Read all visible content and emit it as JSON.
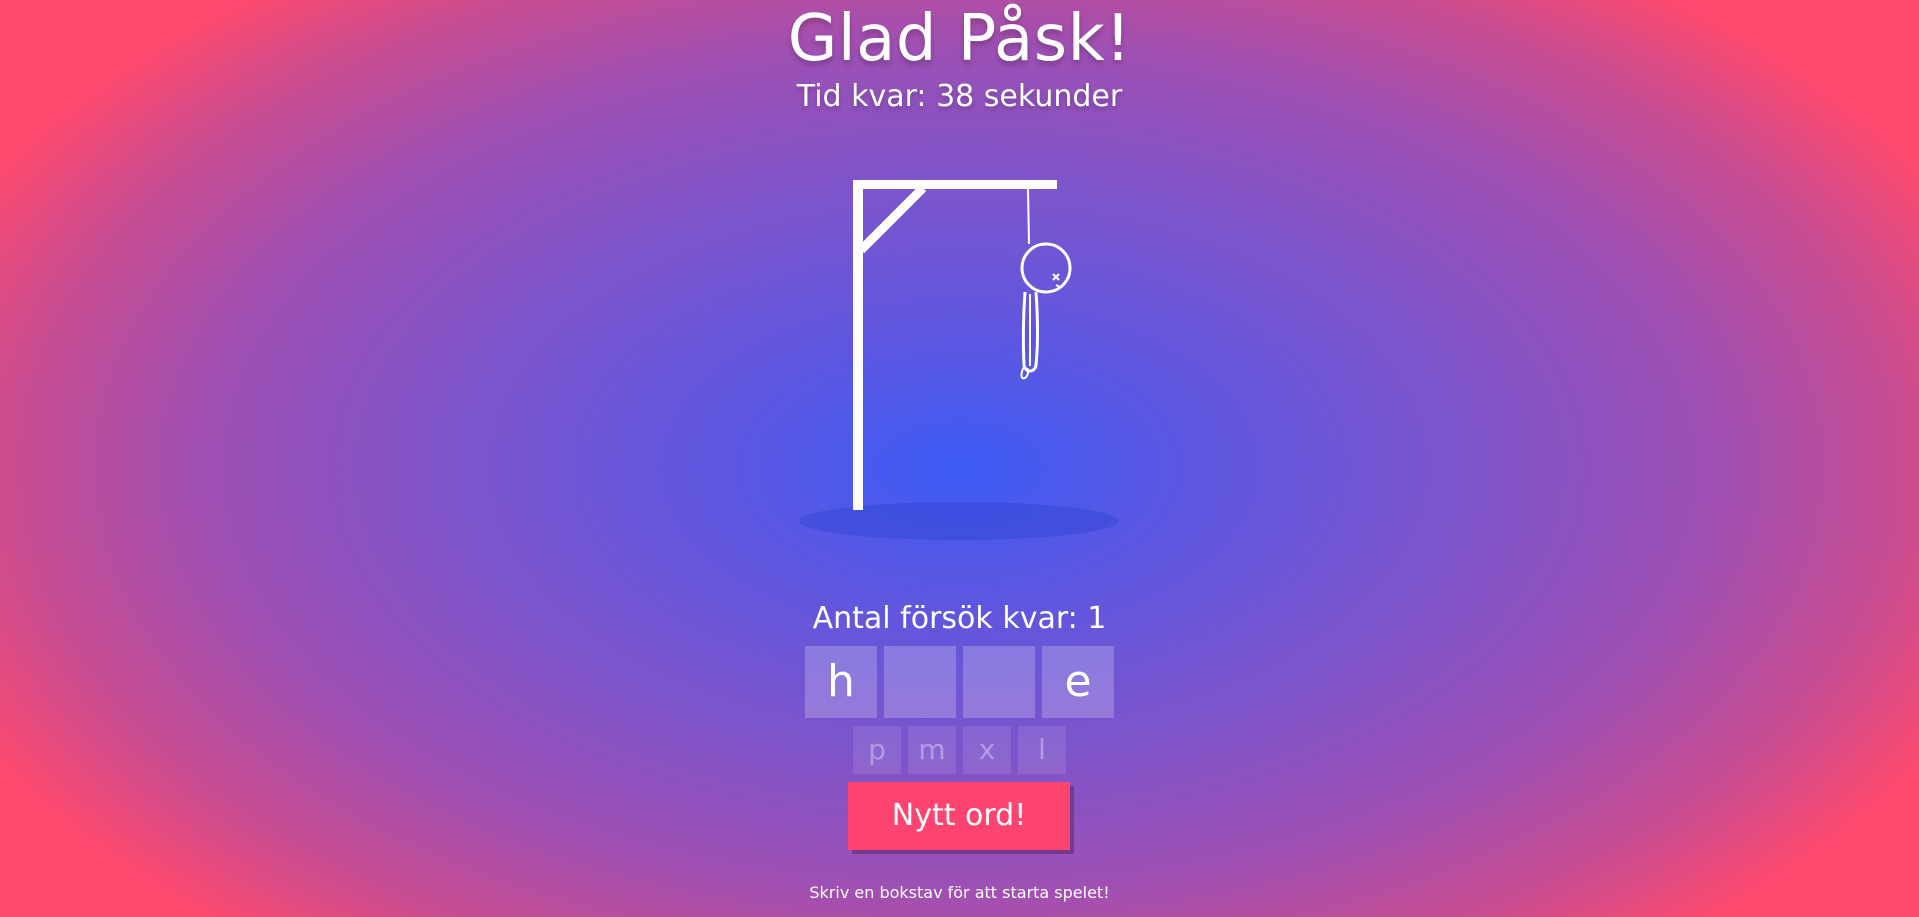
{
  "header": {
    "title": "Glad Påsk!",
    "timer_text": "Tid kvar: 38 sekunder"
  },
  "game": {
    "attempts_text": "Antal försök kvar: 1",
    "word_slots": [
      "h",
      "",
      "",
      "e"
    ],
    "guessed_letters": [
      "p",
      "m",
      "x",
      "l"
    ],
    "new_word_label": "Nytt ord!",
    "hint": "Skriv en bokstav för att starta spelet!"
  },
  "colors": {
    "button": "#ff4470",
    "background_center": "#3d5cf5",
    "background_edge": "#ff4a6e"
  },
  "icons": {
    "drawing": "hangman-figure-icon"
  }
}
